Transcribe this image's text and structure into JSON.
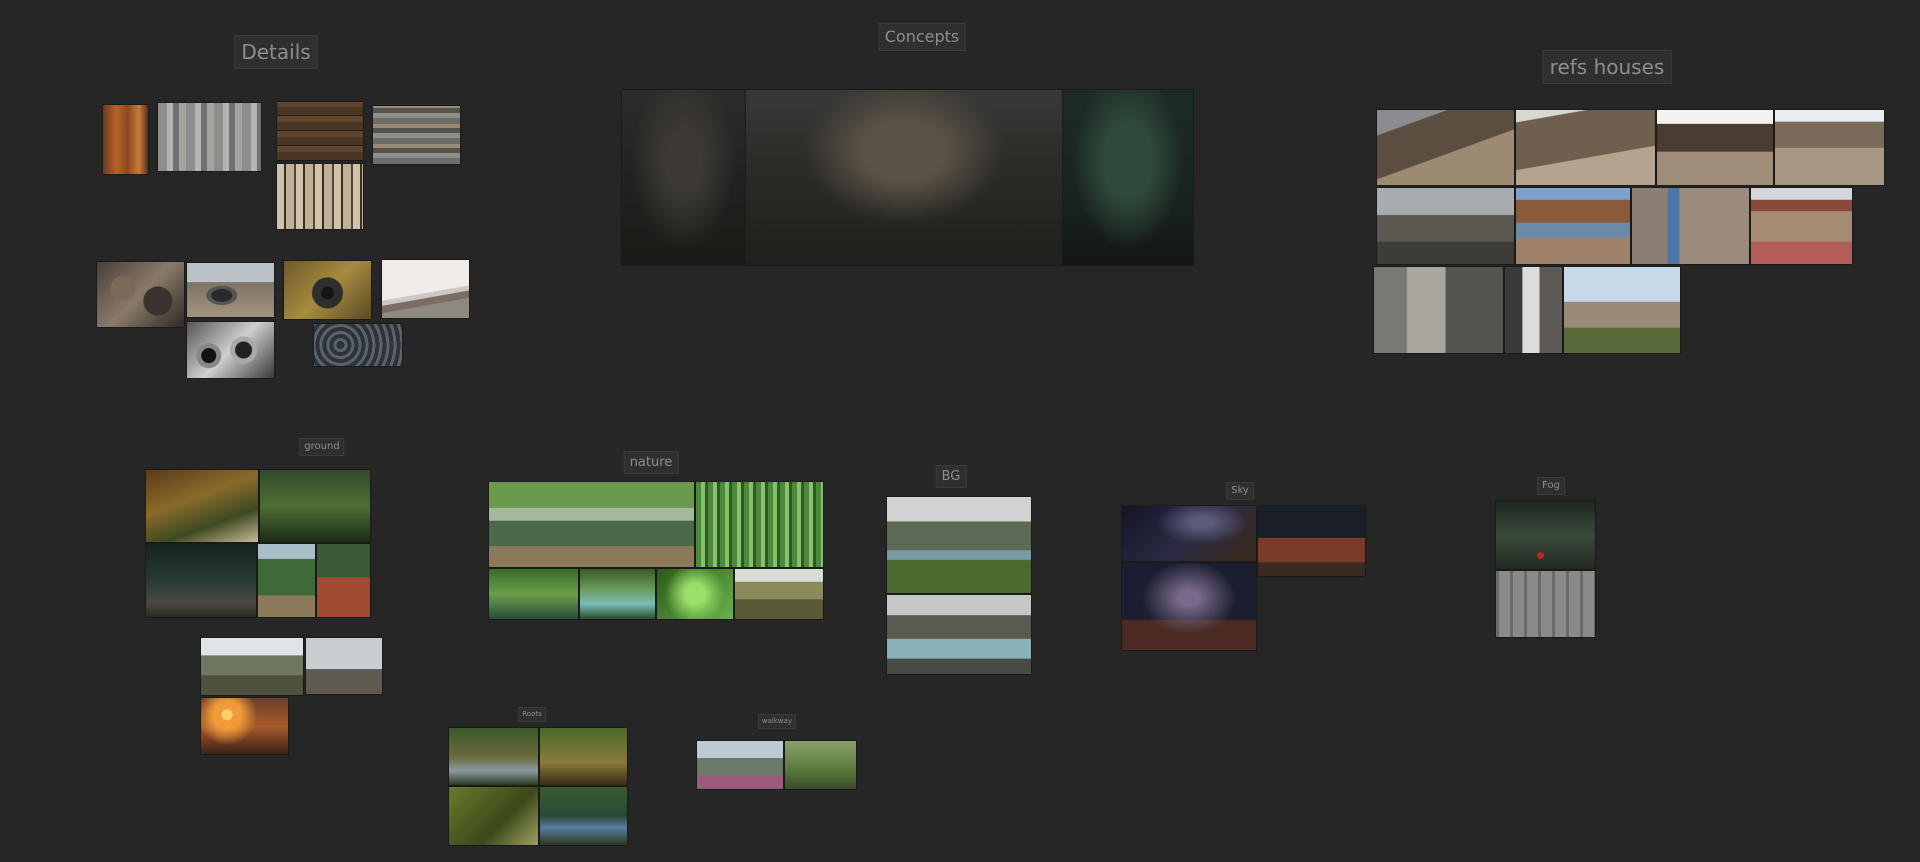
{
  "board": {
    "groups": [
      {
        "id": "details",
        "label": "Details"
      },
      {
        "id": "concepts",
        "label": "Concepts"
      },
      {
        "id": "refs-houses",
        "label": "refs houses"
      },
      {
        "id": "ground",
        "label": "ground"
      },
      {
        "id": "nature",
        "label": "nature"
      },
      {
        "id": "bg",
        "label": "BG"
      },
      {
        "id": "sky",
        "label": "Sky"
      },
      {
        "id": "fog",
        "label": "Fog"
      },
      {
        "id": "roots",
        "label": "Roots"
      },
      {
        "id": "walkway",
        "label": "walkway"
      }
    ]
  }
}
